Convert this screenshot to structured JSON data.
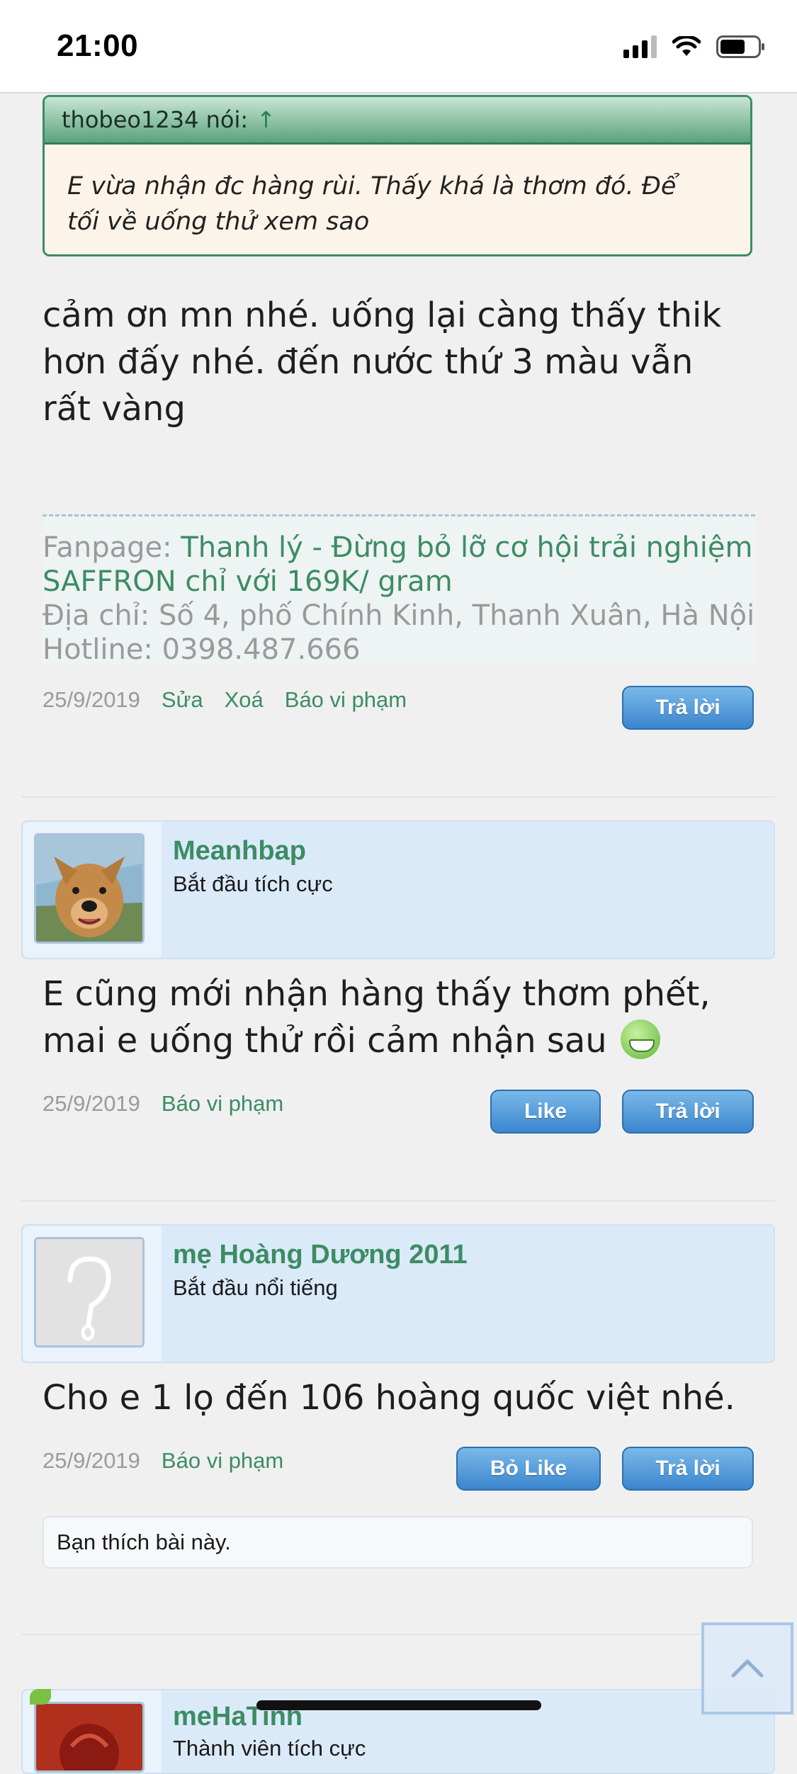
{
  "status_bar": {
    "time": "21:00"
  },
  "quote": {
    "author_label": "thobeo1234 nói:",
    "arrow": "↑",
    "text_line1": "E vừa nhận đc hàng rùi. Thấy khá là thơm đó. Để",
    "text_line2": "tối về uống thử xem sao"
  },
  "post1": {
    "text_line1": "cảm ơn mn nhé. uống lại càng thấy thik",
    "text_line2": "hơn đấy nhé. đến nước thứ 3 màu vẫn",
    "text_line3": "rất vàng",
    "signature": {
      "fanpage_label": "Fanpage: ",
      "fanpage_link_line1": "Thanh lý - Đừng bỏ lỡ cơ hội trải nghiệm",
      "fanpage_link_line2": "SAFFRON chỉ với 169K/ gram",
      "address": "Địa chỉ: Số 4, phố Chính Kinh, Thanh Xuân, Hà Nội",
      "hotline": "Hotline: 0398.487.666"
    },
    "date": "25/9/2019",
    "edit": "Sửa",
    "delete": "Xoá",
    "report": "Báo vi phạm",
    "reply": "Trả lời"
  },
  "post2": {
    "user": "Meanhbap",
    "rank": "Bắt đầu tích cực",
    "text_line1": "E cũng mới nhận hàng thấy thơm phết,",
    "text_line2": "mai e uống thử rồi cảm nhận sau",
    "date": "25/9/2019",
    "report": "Báo vi phạm",
    "like": "Like",
    "reply": "Trả lời"
  },
  "post3": {
    "user": "mẹ Hoàng Dương 2011",
    "rank": "Bắt đầu nổi tiếng",
    "text_line1": "Cho e 1 lọ đến 106 hoàng quốc việt nhé.",
    "date": "25/9/2019",
    "report": "Báo vi phạm",
    "unlike": "Bỏ Like",
    "reply": "Trả lời",
    "likes_note": "Bạn thích bài này."
  },
  "post4": {
    "user": "meHaTinh",
    "rank": "Thành viên tích cực"
  },
  "colors": {
    "accent_green": "#3c8c64",
    "button_blue": "#3b86cf",
    "card_blue": "#dbeaf9"
  }
}
